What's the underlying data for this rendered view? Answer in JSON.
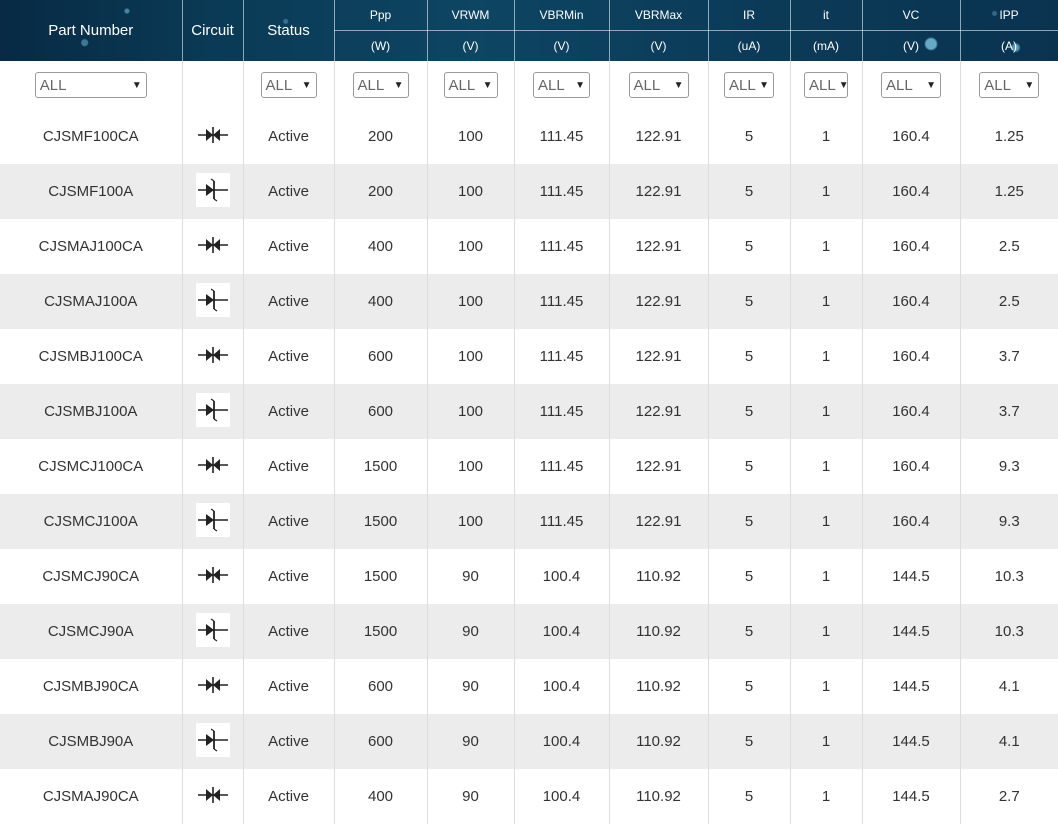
{
  "headers": [
    {
      "name": "Part Number",
      "unit": ""
    },
    {
      "name": "Circuit",
      "unit": ""
    },
    {
      "name": "Status",
      "unit": ""
    },
    {
      "name": "Ppp",
      "unit": "(W)"
    },
    {
      "name": "VRWM",
      "unit": "(V)"
    },
    {
      "name": "VBRMin",
      "unit": "(V)"
    },
    {
      "name": "VBRMax",
      "unit": "(V)"
    },
    {
      "name": "IR",
      "unit": "(uA)"
    },
    {
      "name": "it",
      "unit": "(mA)"
    },
    {
      "name": "VC",
      "unit": "(V)"
    },
    {
      "name": "IPP",
      "unit": "(A)"
    }
  ],
  "filters": {
    "part_number": "ALL",
    "status": "ALL",
    "ppp": "ALL",
    "vrwm": "ALL",
    "vbrmin": "ALL",
    "vbrmax": "ALL",
    "ir": "ALL",
    "it": "ALL",
    "vc": "ALL",
    "ipp": "ALL"
  },
  "rows": [
    {
      "part": "CJSMF100CA",
      "circuit": "bidirectional-tvs-icon",
      "status": "Active",
      "ppp": "200",
      "vrwm": "100",
      "vbrmin": "111.45",
      "vbrmax": "122.91",
      "ir": "5",
      "it": "1",
      "vc": "160.4",
      "ipp": "1.25"
    },
    {
      "part": "CJSMF100A",
      "circuit": "unidirectional-tvs-icon",
      "status": "Active",
      "ppp": "200",
      "vrwm": "100",
      "vbrmin": "111.45",
      "vbrmax": "122.91",
      "ir": "5",
      "it": "1",
      "vc": "160.4",
      "ipp": "1.25"
    },
    {
      "part": "CJSMAJ100CA",
      "circuit": "bidirectional-tvs-icon",
      "status": "Active",
      "ppp": "400",
      "vrwm": "100",
      "vbrmin": "111.45",
      "vbrmax": "122.91",
      "ir": "5",
      "it": "1",
      "vc": "160.4",
      "ipp": "2.5"
    },
    {
      "part": "CJSMAJ100A",
      "circuit": "unidirectional-tvs-icon",
      "status": "Active",
      "ppp": "400",
      "vrwm": "100",
      "vbrmin": "111.45",
      "vbrmax": "122.91",
      "ir": "5",
      "it": "1",
      "vc": "160.4",
      "ipp": "2.5"
    },
    {
      "part": "CJSMBJ100CA",
      "circuit": "bidirectional-tvs-icon",
      "status": "Active",
      "ppp": "600",
      "vrwm": "100",
      "vbrmin": "111.45",
      "vbrmax": "122.91",
      "ir": "5",
      "it": "1",
      "vc": "160.4",
      "ipp": "3.7"
    },
    {
      "part": "CJSMBJ100A",
      "circuit": "unidirectional-tvs-icon",
      "status": "Active",
      "ppp": "600",
      "vrwm": "100",
      "vbrmin": "111.45",
      "vbrmax": "122.91",
      "ir": "5",
      "it": "1",
      "vc": "160.4",
      "ipp": "3.7"
    },
    {
      "part": "CJSMCJ100CA",
      "circuit": "bidirectional-tvs-icon",
      "status": "Active",
      "ppp": "1500",
      "vrwm": "100",
      "vbrmin": "111.45",
      "vbrmax": "122.91",
      "ir": "5",
      "it": "1",
      "vc": "160.4",
      "ipp": "9.3"
    },
    {
      "part": "CJSMCJ100A",
      "circuit": "unidirectional-tvs-icon",
      "status": "Active",
      "ppp": "1500",
      "vrwm": "100",
      "vbrmin": "111.45",
      "vbrmax": "122.91",
      "ir": "5",
      "it": "1",
      "vc": "160.4",
      "ipp": "9.3"
    },
    {
      "part": "CJSMCJ90CA",
      "circuit": "bidirectional-tvs-icon",
      "status": "Active",
      "ppp": "1500",
      "vrwm": "90",
      "vbrmin": "100.4",
      "vbrmax": "110.92",
      "ir": "5",
      "it": "1",
      "vc": "144.5",
      "ipp": "10.3"
    },
    {
      "part": "CJSMCJ90A",
      "circuit": "unidirectional-tvs-icon",
      "status": "Active",
      "ppp": "1500",
      "vrwm": "90",
      "vbrmin": "100.4",
      "vbrmax": "110.92",
      "ir": "5",
      "it": "1",
      "vc": "144.5",
      "ipp": "10.3"
    },
    {
      "part": "CJSMBJ90CA",
      "circuit": "bidirectional-tvs-icon",
      "status": "Active",
      "ppp": "600",
      "vrwm": "90",
      "vbrmin": "100.4",
      "vbrmax": "110.92",
      "ir": "5",
      "it": "1",
      "vc": "144.5",
      "ipp": "4.1"
    },
    {
      "part": "CJSMBJ90A",
      "circuit": "unidirectional-tvs-icon",
      "status": "Active",
      "ppp": "600",
      "vrwm": "90",
      "vbrmin": "100.4",
      "vbrmax": "110.92",
      "ir": "5",
      "it": "1",
      "vc": "144.5",
      "ipp": "4.1"
    },
    {
      "part": "CJSMAJ90CA",
      "circuit": "bidirectional-tvs-icon",
      "status": "Active",
      "ppp": "400",
      "vrwm": "90",
      "vbrmin": "100.4",
      "vbrmax": "110.92",
      "ir": "5",
      "it": "1",
      "vc": "144.5",
      "ipp": "2.7"
    }
  ],
  "colors": {
    "header_bg": "#0a3a55",
    "row_odd": "#ececec",
    "row_even": "#ffffff",
    "text": "#333333"
  }
}
